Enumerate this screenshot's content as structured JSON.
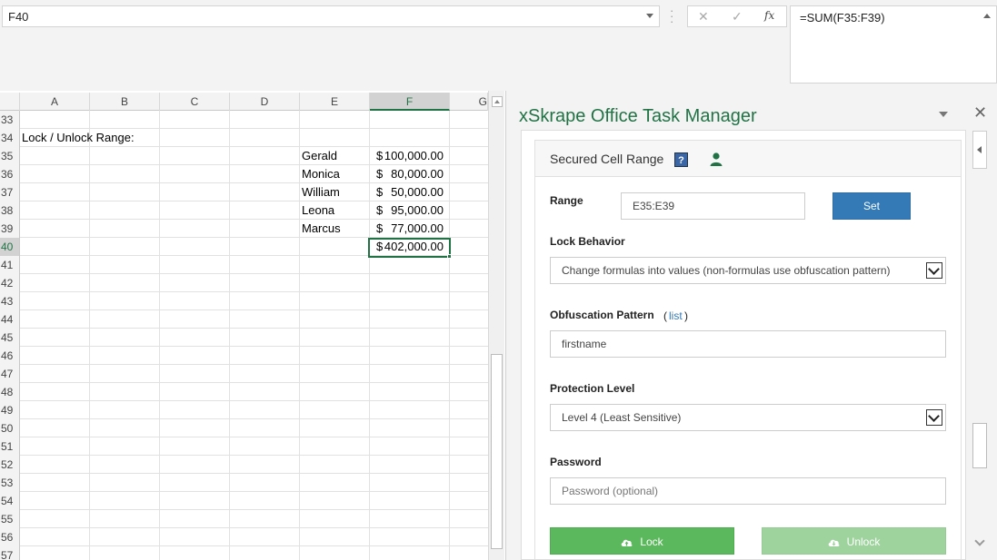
{
  "formula_bar": {
    "name_box": "F40",
    "cancel_glyph": "✕",
    "enter_glyph": "✓",
    "fx_label": "fx",
    "formula": "=SUM(F35:F39)"
  },
  "grid": {
    "columns": [
      "A",
      "B",
      "C",
      "D",
      "E",
      "F",
      "G"
    ],
    "selected_column": "F",
    "selected_row": "40",
    "rows": [
      {
        "num": "33"
      },
      {
        "num": "34",
        "a": "Lock / Unlock Range:"
      },
      {
        "num": "35",
        "e": "Gerald",
        "f_cur": "$",
        "f_val": "100,000.00"
      },
      {
        "num": "36",
        "e": "Monica",
        "f_cur": "$",
        "f_val": "80,000.00"
      },
      {
        "num": "37",
        "e": "William",
        "f_cur": "$",
        "f_val": "50,000.00"
      },
      {
        "num": "38",
        "e": "Leona",
        "f_cur": "$",
        "f_val": "95,000.00"
      },
      {
        "num": "39",
        "e": "Marcus",
        "f_cur": "$",
        "f_val": "77,000.00"
      },
      {
        "num": "40",
        "f_cur": "$",
        "f_val": "402,000.00"
      },
      {
        "num": "41"
      },
      {
        "num": "42"
      },
      {
        "num": "43"
      },
      {
        "num": "44"
      },
      {
        "num": "45"
      },
      {
        "num": "46"
      },
      {
        "num": "47"
      },
      {
        "num": "48"
      },
      {
        "num": "49"
      },
      {
        "num": "50"
      },
      {
        "num": "51"
      },
      {
        "num": "52"
      },
      {
        "num": "53"
      },
      {
        "num": "54"
      },
      {
        "num": "55"
      },
      {
        "num": "56"
      },
      {
        "num": "57"
      }
    ]
  },
  "task_pane": {
    "title": "xSkrape Office Task Manager",
    "close_glyph": "✕",
    "section_title": "Secured Cell Range",
    "help_glyph": "?",
    "range_label": "Range",
    "range_value": "E35:E39",
    "set_button": "Set",
    "lock_behavior_label": "Lock Behavior",
    "lock_behavior_value": "Change formulas into values (non-formulas use obfuscation pattern)",
    "obfuscation_label": "Obfuscation Pattern",
    "list_paren_open": "(",
    "list_link": "list",
    "list_paren_close": ")",
    "obfuscation_value": "firstname",
    "protection_label": "Protection Level",
    "protection_value": "Level 4 (Least Sensitive)",
    "password_label": "Password",
    "password_placeholder": "Password (optional)",
    "lock_button": "Lock",
    "unlock_button": "Unlock"
  },
  "colors": {
    "excel_green": "#217346",
    "set_blue": "#337ab7",
    "lock_green": "#5cb85c",
    "unlock_green_disabled": "#9ed39e"
  }
}
